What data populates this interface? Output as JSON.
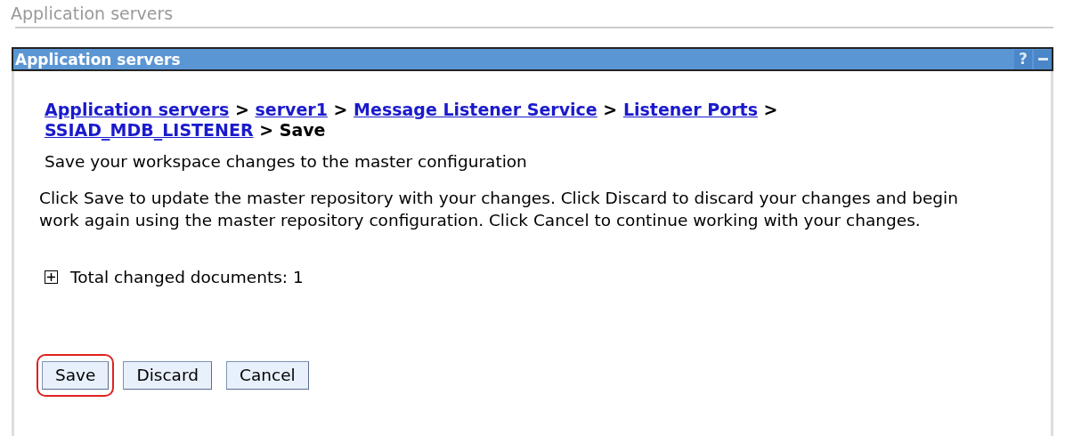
{
  "page_title": "Application servers",
  "panel": {
    "title": "Application servers",
    "header_buttons": [
      {
        "kind": "help",
        "label": "?"
      },
      {
        "kind": "minimize"
      }
    ]
  },
  "breadcrumb": {
    "separator": ">",
    "items": [
      {
        "label": "Application servers",
        "kind": "link"
      },
      {
        "label": "server1",
        "kind": "link"
      },
      {
        "label": "Message Listener Service",
        "kind": "link"
      },
      {
        "label": "Listener Ports",
        "kind": "link"
      },
      {
        "label": "SSIAD_MDB_LISTENER",
        "kind": "link"
      },
      {
        "label": "Save",
        "kind": "current"
      }
    ]
  },
  "subtitle": "Save your workspace changes to the master configuration",
  "description": "Click Save to update the master repository with your changes. Click Discard to discard your changes and begin work again using the master repository configuration. Click Cancel to continue working with your changes.",
  "changed_documents": {
    "label": "Total changed documents: 1",
    "expanded": false
  },
  "buttons": [
    {
      "label": "Save",
      "highlighted": true
    },
    {
      "label": "Discard",
      "highlighted": false
    },
    {
      "label": "Cancel",
      "highlighted": false
    }
  ]
}
